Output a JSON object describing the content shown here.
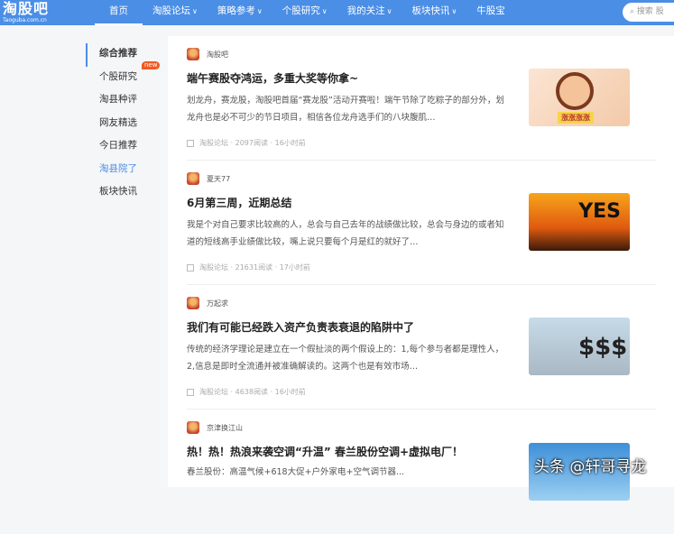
{
  "header": {
    "logo": "淘股吧",
    "logo_sub": "Taoguba.com.cn",
    "nav": [
      {
        "label": "首页",
        "active": true
      },
      {
        "label": "淘股论坛",
        "dropdown": true
      },
      {
        "label": "策略参考",
        "dropdown": true
      },
      {
        "label": "个股研究",
        "dropdown": true
      },
      {
        "label": "我的关注",
        "dropdown": true
      },
      {
        "label": "板块快讯",
        "dropdown": true
      },
      {
        "label": "牛股宝"
      }
    ],
    "search_placeholder": "搜索 股"
  },
  "sidebar": {
    "items": [
      {
        "label": "综合推荐"
      },
      {
        "label": "个股研究",
        "badge": "new"
      },
      {
        "label": "淘县种评"
      },
      {
        "label": "网友精选"
      },
      {
        "label": "今日推荐"
      },
      {
        "label": "淘县院了"
      },
      {
        "label": "板块快讯"
      }
    ]
  },
  "articles": [
    {
      "author": "淘股吧",
      "title": "端午赛股夺鸿运，多重大奖等你拿~",
      "summary": "划龙舟，赛龙股，淘股吧首届“赛龙股”活动开赛啦！端午节除了吃粽子的部分外，划龙舟也是必不可少的节日项目，相信各位龙舟选手们的八块腹肌…",
      "meta": "淘股论坛 · 2097阅读 · 16小时前",
      "thumb_text": "涨涨涨涨"
    },
    {
      "author": "夏天77",
      "title": "6月第三周，近期总结",
      "summary": "我是个对自己要求比较高的人，总会与自己去年的战绩做比较，总会与身边的或者知道的短线高手业绩做比较，嘴上说只要每个月是红的就好了…",
      "meta": "淘股论坛 · 21631阅读 · 17小时前",
      "thumb_text": "YES"
    },
    {
      "author": "万起求",
      "title": "我们有可能已经跌入资产负责表衰退的陷阱中了",
      "summary": "传统的经济学理论是建立在一个假扯淡的两个假设上的：1,每个参与者都是理性人，2,信息是即时全流通并被准确解读的。这两个也是有效市场…",
      "meta": "淘股论坛 · 4638阅读 · 16小时前",
      "thumb_text": "$$$"
    },
    {
      "author": "京津换江山",
      "title": "热！热！热浪来袭空调“升温” 春兰股份空调+虚拟电厂！",
      "summary": "春兰股份：高温气候+618大促+户外家电+空气调节器...",
      "meta": "",
      "thumb_text": ""
    }
  ],
  "watermark": "头条 @轩哥寻龙"
}
